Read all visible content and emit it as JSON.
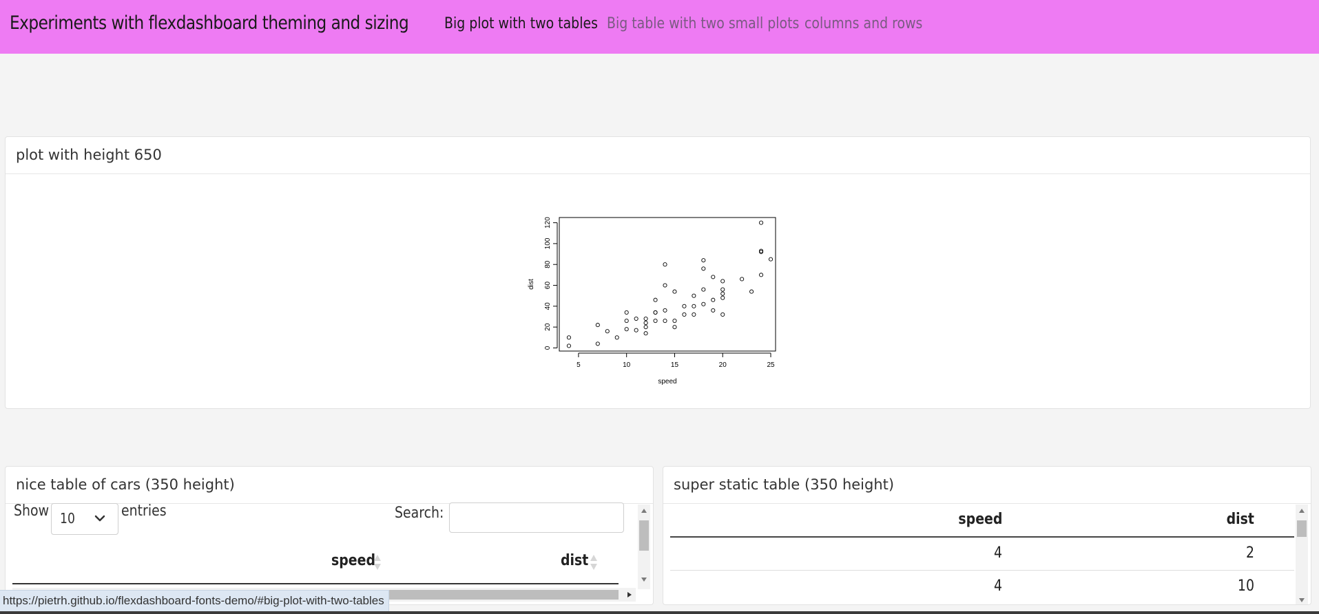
{
  "navbar": {
    "brand": "Experiments with flexdashboard theming and sizing",
    "links": [
      {
        "label": "Big plot with two tables",
        "active": true
      },
      {
        "label": "Big table with two small plots",
        "active": false
      },
      {
        "label": "columns and rows",
        "active": false
      }
    ]
  },
  "plot_panel": {
    "title": "plot with height 650"
  },
  "chart_data": {
    "type": "scatter",
    "title": "",
    "xlabel": "speed",
    "ylabel": "dist",
    "xlim": [
      3,
      25.5
    ],
    "ylim": [
      -3,
      125
    ],
    "xticks": [
      "5",
      "10",
      "15",
      "20",
      "25"
    ],
    "yticks": [
      "0",
      "20",
      "40",
      "60",
      "80",
      "100",
      "120"
    ],
    "grid": false,
    "marker": "open-circle",
    "x": [
      4,
      4,
      7,
      7,
      8,
      9,
      10,
      10,
      10,
      11,
      11,
      12,
      12,
      12,
      12,
      13,
      13,
      13,
      13,
      14,
      14,
      14,
      14,
      15,
      15,
      15,
      16,
      16,
      17,
      17,
      17,
      18,
      18,
      18,
      18,
      19,
      19,
      19,
      20,
      20,
      20,
      20,
      20,
      22,
      23,
      24,
      24,
      24,
      24,
      25
    ],
    "y": [
      2,
      10,
      4,
      22,
      16,
      10,
      18,
      26,
      34,
      17,
      28,
      14,
      20,
      24,
      28,
      26,
      34,
      34,
      46,
      26,
      36,
      60,
      80,
      20,
      26,
      54,
      32,
      40,
      32,
      40,
      50,
      42,
      56,
      76,
      84,
      36,
      46,
      68,
      32,
      48,
      52,
      56,
      64,
      66,
      54,
      70,
      92,
      93,
      120,
      85
    ]
  },
  "table_panel": {
    "title": "nice table of cars (350 height)",
    "show_label": "Show",
    "page_length": "10",
    "entries_label": "entries",
    "search_label": "Search:",
    "search_value": "",
    "columns": [
      "speed",
      "dist"
    ]
  },
  "static_panel": {
    "title": "super static table (350 height)",
    "columns": [
      "speed",
      "dist"
    ],
    "rows": [
      [
        "4",
        "2"
      ],
      [
        "4",
        "10"
      ]
    ]
  },
  "statusbar": {
    "url": "https://pietrh.github.io/flexdashboard-fonts-demo/#big-plot-with-two-tables"
  }
}
